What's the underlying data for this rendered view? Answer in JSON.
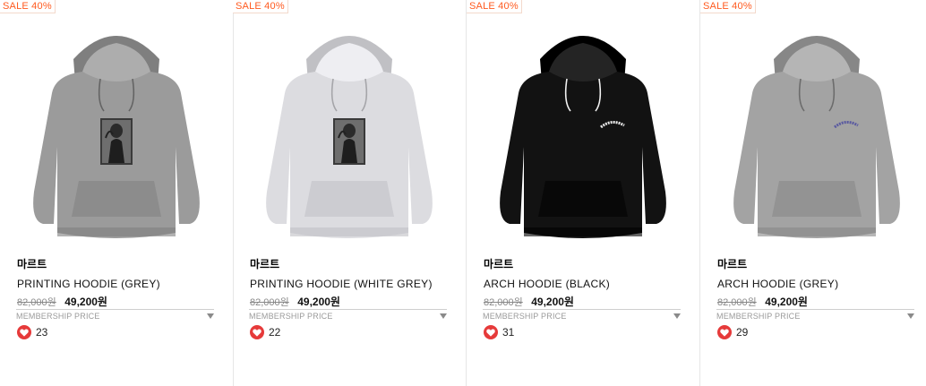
{
  "products": [
    {
      "sale_badge": "SALE 40%",
      "brand": "마르트",
      "name": "PRINTING HOODIE (GREY)",
      "original_price": "82,000원",
      "sale_price": "49,200원",
      "membership_label": "MEMBERSHIP PRICE",
      "likes": "23",
      "hoodie_color": "#9b9b9b",
      "print": "photo"
    },
    {
      "sale_badge": "SALE 40%",
      "brand": "마르트",
      "name": "PRINTING HOODIE (WHITE GREY)",
      "original_price": "82,000원",
      "sale_price": "49,200원",
      "membership_label": "MEMBERSHIP PRICE",
      "likes": "22",
      "hoodie_color": "#dcdce0",
      "print": "photo"
    },
    {
      "sale_badge": "SALE 40%",
      "brand": "마르트",
      "name": "ARCH HOODIE (BLACK)",
      "original_price": "82,000원",
      "sale_price": "49,200원",
      "membership_label": "MEMBERSHIP PRICE",
      "likes": "31",
      "hoodie_color": "#121212",
      "print": "arch"
    },
    {
      "sale_badge": "SALE 40%",
      "brand": "마르트",
      "name": "ARCH HOODIE (GREY)",
      "original_price": "82,000원",
      "sale_price": "49,200원",
      "membership_label": "MEMBERSHIP PRICE",
      "likes": "29",
      "hoodie_color": "#a3a3a3",
      "print": "arch"
    }
  ],
  "colors": {
    "sale_badge": "#ff5a1f",
    "heart": "#e63a3a"
  }
}
